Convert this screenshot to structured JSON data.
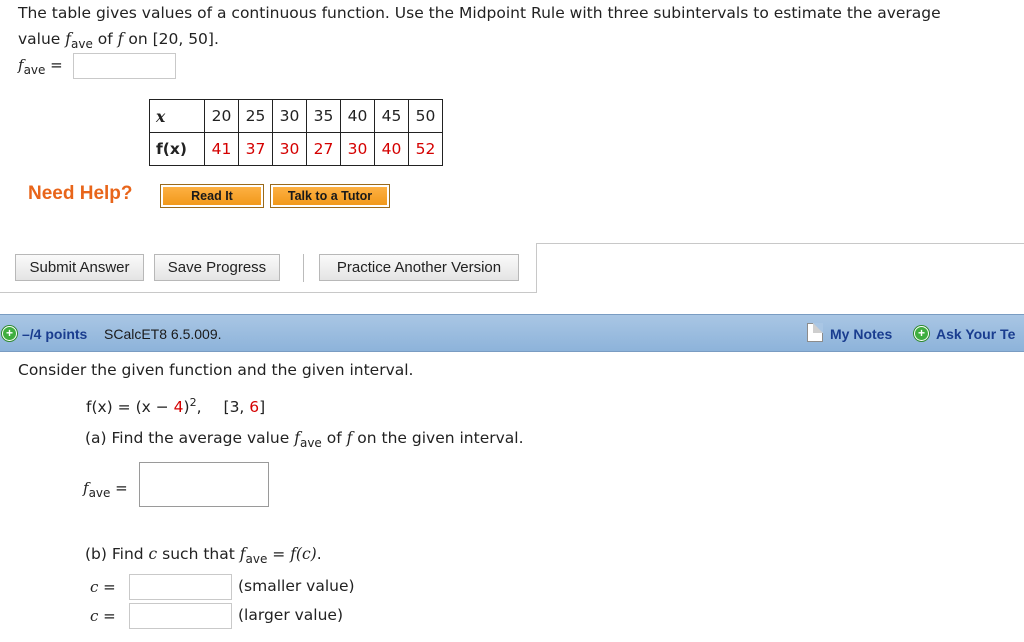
{
  "q1": {
    "line1": "The table gives values of a continuous function. Use the Midpoint Rule with three subintervals to estimate the average",
    "line2_pre": "value ",
    "f": "f",
    "sub_ave": "ave",
    "line2_mid": " of ",
    "line2_post": " on [20, 50].",
    "answer_label_eq": " =",
    "table": {
      "x_header": "x",
      "fx_header": "f(x)",
      "x_values": [
        "20",
        "25",
        "30",
        "35",
        "40",
        "45",
        "50"
      ],
      "fx_values": [
        "41",
        "37",
        "30",
        "27",
        "30",
        "40",
        "52"
      ]
    },
    "need_help": "Need Help?",
    "read_it": "Read It",
    "talk_to_tutor": "Talk to a Tutor"
  },
  "actions": {
    "submit": "Submit Answer",
    "save": "Save Progress",
    "practice": "Practice Another Version"
  },
  "q2_header": {
    "points": "–/4 points",
    "code": "SCalcET8 6.5.009.",
    "my_notes": "My Notes",
    "ask_your": "Ask Your Te"
  },
  "q2": {
    "intro": "Consider the given function and the given interval.",
    "func_pre": "f(x) = (x − ",
    "func_four": "4",
    "func_post": ")",
    "func_exp": "2",
    "func_comma": ",",
    "interval_open": "[3, ",
    "interval_six": "6",
    "interval_close": "]",
    "part_a_pre": "(a) Find the average value ",
    "part_a_mid": " of ",
    "part_a_post": " on the given interval.",
    "part_b_pre": "(b) Find ",
    "c": "c",
    "part_b_mid": " such that ",
    "part_b_eq": " = ",
    "part_b_fc": "f(c)",
    "part_b_end": ".",
    "c_eq": " =",
    "smaller": "(smaller value)",
    "larger": "(larger value)"
  },
  "colors": {
    "red": "#d40000",
    "link_blue": "#1a3d8f",
    "help_orange": "#e8651a",
    "bar_blue": "#9dbde0"
  }
}
